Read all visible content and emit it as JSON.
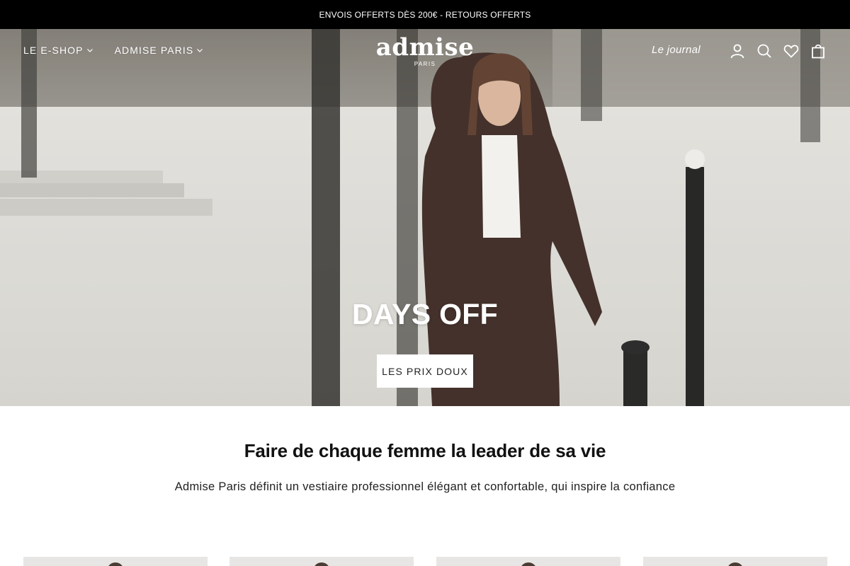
{
  "announcement": {
    "text": "ENVOIS OFFERTS DÈS 200€ - RETOURS OFFERTS"
  },
  "header": {
    "nav": [
      {
        "label": "LE E-SHOP"
      },
      {
        "label": "ADMISE PARIS"
      }
    ],
    "logo": {
      "brand": "admise",
      "subtitle": "PARIS"
    },
    "journal_link": "Le journal",
    "icons": [
      "account-icon",
      "search-icon",
      "heart-icon",
      "bag-icon"
    ]
  },
  "hero": {
    "title": "DAYS OFF",
    "cta_label": "LES PRIX DOUX"
  },
  "intro": {
    "title": "Faire de chaque femme la leader de sa vie",
    "text": "Admise Paris définit un vestiaire professionnel élégant et confortable, qui inspire la confiance"
  },
  "colors": {
    "announcement_bg": "#000000",
    "text_primary": "#111111",
    "cta_bg": "#ffffff"
  }
}
